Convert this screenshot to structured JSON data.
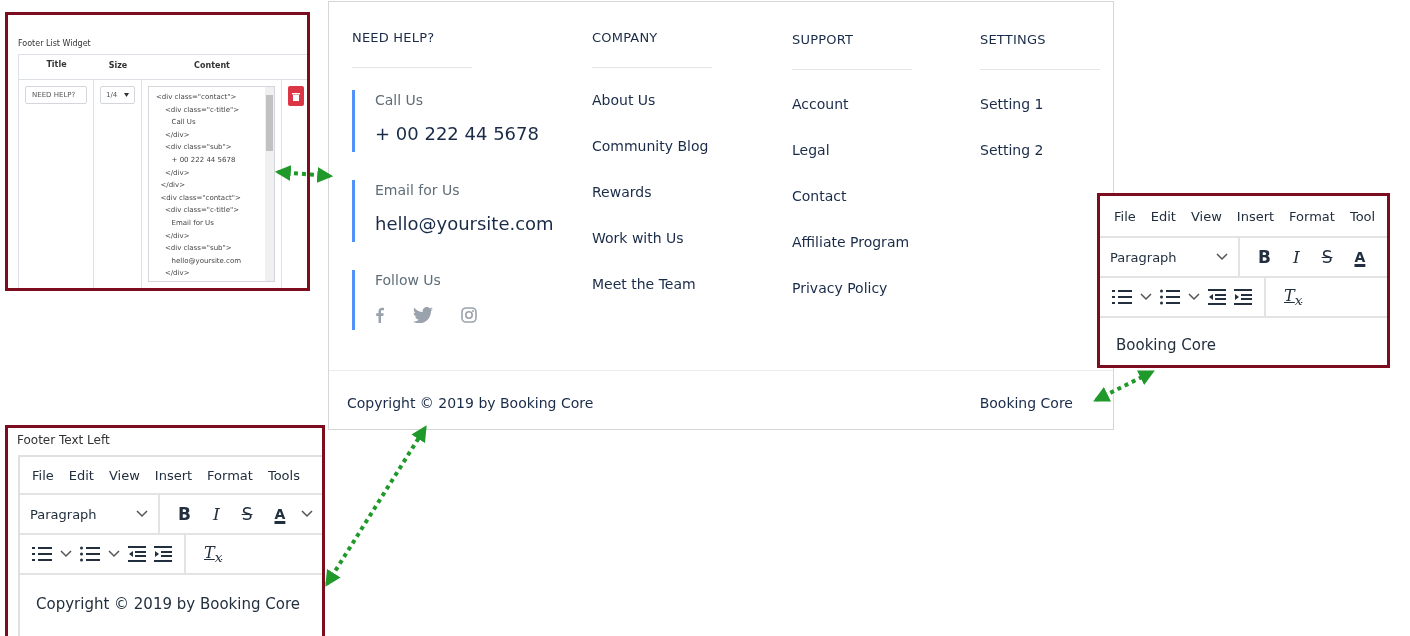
{
  "list_widget": {
    "title": "Footer List Widget",
    "columns": [
      "Title",
      "Size",
      "Content"
    ],
    "row": {
      "title_value": "NEED HELP?",
      "size": "1/4",
      "content": "<div class=\"contact\">\n    <div class=\"c-title\">\n       Call Us\n    </div>\n    <div class=\"sub\">\n       + 00 222 44 5678\n    </div>\n  </div>\n  <div class=\"contact\">\n    <div class=\"c-title\">\n       Email for Us\n    </div>\n    <div class=\"sub\">\n       hello@yoursite.com\n    </div>"
    }
  },
  "footer": {
    "columns": [
      {
        "heading": "NEED HELP?",
        "kind": "contacts",
        "contacts": [
          {
            "label": "Call Us",
            "value": "+ 00 222 44 5678"
          },
          {
            "label": "Email for Us",
            "value": "hello@yoursite.com"
          },
          {
            "label": "Follow Us",
            "kind": "social"
          }
        ]
      },
      {
        "heading": "COMPANY",
        "kind": "links",
        "links": [
          "About Us",
          "Community Blog",
          "Rewards",
          "Work with Us",
          "Meet the Team"
        ]
      },
      {
        "heading": "SUPPORT",
        "kind": "links",
        "links": [
          "Account",
          "Legal",
          "Contact",
          "Affiliate Program",
          "Privacy Policy"
        ]
      },
      {
        "heading": "SETTINGS",
        "kind": "links",
        "links": [
          "Setting 1",
          "Setting 2"
        ]
      }
    ],
    "copyright": "Copyright © 2019 by Booking Core",
    "right_text": "Booking Core"
  },
  "editors": [
    {
      "label": "Footer Text Left",
      "menu": [
        "File",
        "Edit",
        "View",
        "Insert",
        "Format",
        "Tools"
      ],
      "block_format": "Paragraph",
      "format_buttons": [
        {
          "kind": "bold",
          "glyph": "B"
        },
        {
          "kind": "italic",
          "glyph": "I"
        },
        {
          "kind": "strike",
          "glyph": "S"
        },
        {
          "kind": "color",
          "glyph": "A"
        }
      ],
      "clear_glyph": "T$_{x}$",
      "content": "Copyright © 2019 by Booking Core"
    },
    {
      "menu": [
        "File",
        "Edit",
        "View",
        "Insert",
        "Format",
        "Tool"
      ],
      "block_format": "Paragraph",
      "format_buttons": [
        {
          "kind": "bold",
          "glyph": "B"
        },
        {
          "kind": "italic",
          "glyph": "I"
        },
        {
          "kind": "strike",
          "glyph": "S"
        },
        {
          "kind": "color",
          "glyph": "A"
        }
      ],
      "clear_glyph": "T$_{x}$",
      "content": "Booking Core"
    }
  ]
}
